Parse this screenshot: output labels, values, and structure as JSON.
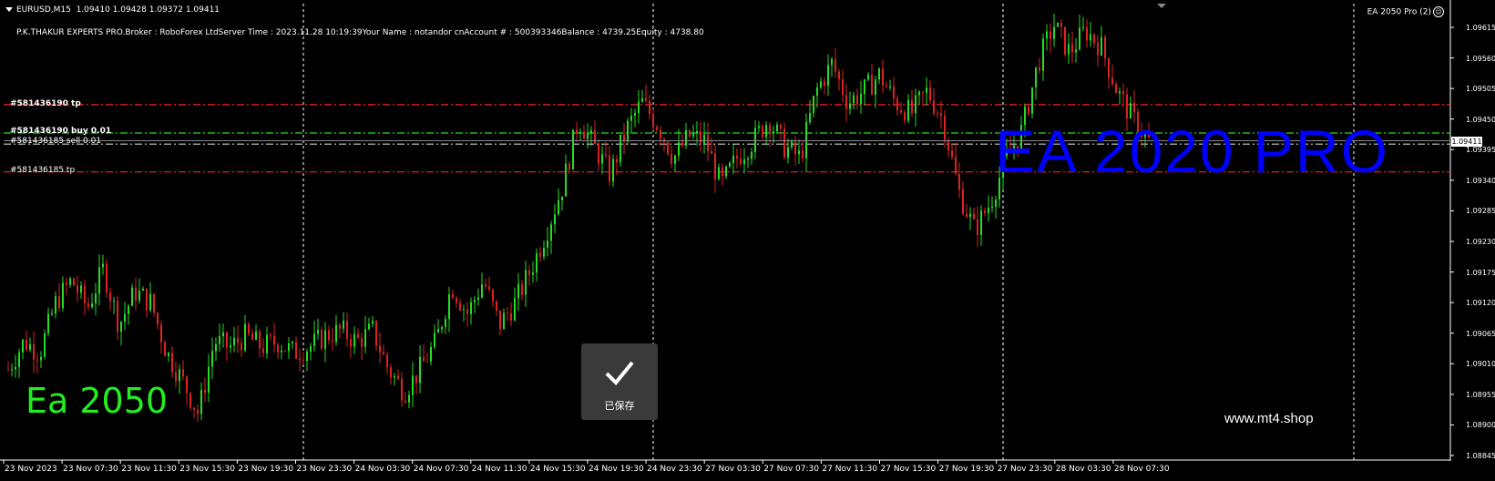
{
  "symbol": {
    "name": "EURUSD,M15",
    "ohlc": "1.09410 1.09428 1.09372 1.09411"
  },
  "account_info": "P.K.THAKUR EXPERTS PRO.Broker   : RoboForex LtdServer Time : 2023.11.28 10:19:39Your Name     : notandor cnAccount #   : 500393346Balance : 4739.25Equity     : 4738.80",
  "ea_badge": {
    "label": "EA 2050 Pro",
    "count": "(2)",
    "icon": "smiley-icon"
  },
  "order_labels": [
    {
      "text": "#581436190 tp",
      "price": 1.09476,
      "color": "#ff2020",
      "style": "dashdot"
    },
    {
      "text": "#581436190 buy 0.01",
      "price": 1.09425,
      "color": "#22dd22",
      "style": "dashdot"
    },
    {
      "text": "#581436185 sell 0.01",
      "price": 1.09405,
      "color": "#cccccc",
      "style": "dashdot"
    },
    {
      "text": "#581436185 tp",
      "price": 1.09355,
      "color": "#ff2020",
      "style": "dashdot"
    }
  ],
  "price_axis": {
    "ticks": [
      "1.09615",
      "1.09560",
      "1.09505",
      "1.09450",
      "1.09395",
      "1.09340",
      "1.09285",
      "1.09230",
      "1.09175",
      "1.09120",
      "1.09065",
      "1.09010",
      "1.08955",
      "1.08900",
      "1.08845"
    ],
    "current_price": "1.09411",
    "range": [
      1.08845,
      1.09615
    ]
  },
  "time_axis": {
    "ticks": [
      "23 Nov 2023",
      "23 Nov 07:30",
      "23 Nov 11:30",
      "23 Nov 15:30",
      "23 Nov 19:30",
      "23 Nov 23:30",
      "24 Nov 03:30",
      "24 Nov 07:30",
      "24 Nov 11:30",
      "24 Nov 15:30",
      "24 Nov 19:30",
      "24 Nov 23:30",
      "27 Nov 03:30",
      "27 Nov 07:30",
      "27 Nov 11:30",
      "27 Nov 15:30",
      "27 Nov 19:30",
      "27 Nov 23:30",
      "28 Nov 03:30",
      "28 Nov 07:30"
    ]
  },
  "watermarks": {
    "ea2020": "EA 2020 PRO",
    "ea2050": "Ea 2050",
    "website": "www.mt4.shop"
  },
  "toast": {
    "text": "已保存",
    "icon": "checkmark-icon"
  },
  "colors": {
    "bull": "#22dd22",
    "bear": "#dd2222",
    "background": "#000000",
    "grid": "#ffffff"
  },
  "chart_data": {
    "type": "candlestick",
    "title": "EURUSD,M15",
    "ylim": [
      1.08845,
      1.09615
    ],
    "close_path": [
      1.09,
      1.0905,
      1.0903,
      1.0912,
      1.0916,
      1.0911,
      1.0918,
      1.0908,
      1.0914,
      1.0912,
      1.0903,
      1.0898,
      1.0892,
      1.0905,
      1.0904,
      1.0906,
      1.0904,
      1.0905,
      1.0903,
      1.0904,
      1.0906,
      1.0907,
      1.0905,
      1.0907,
      1.09,
      1.0896,
      1.09,
      1.0905,
      1.0915,
      1.091,
      1.0916,
      1.0908,
      1.0912,
      1.0918,
      1.0925,
      1.0933,
      1.0945,
      1.094,
      1.0935,
      1.0943,
      1.0948,
      1.0944,
      1.0938,
      1.0942,
      1.0941,
      1.0933,
      1.0938,
      1.0941,
      1.0945,
      1.094,
      1.0938,
      1.095,
      1.0955,
      1.0948,
      1.095,
      1.0953,
      1.0948,
      1.0946,
      1.095,
      1.0945,
      1.0932,
      1.0925,
      1.093,
      1.0938,
      1.0943,
      1.0955,
      1.0962,
      1.0957,
      1.0961,
      1.0958,
      1.095,
      1.0945,
      1.0941
    ]
  }
}
